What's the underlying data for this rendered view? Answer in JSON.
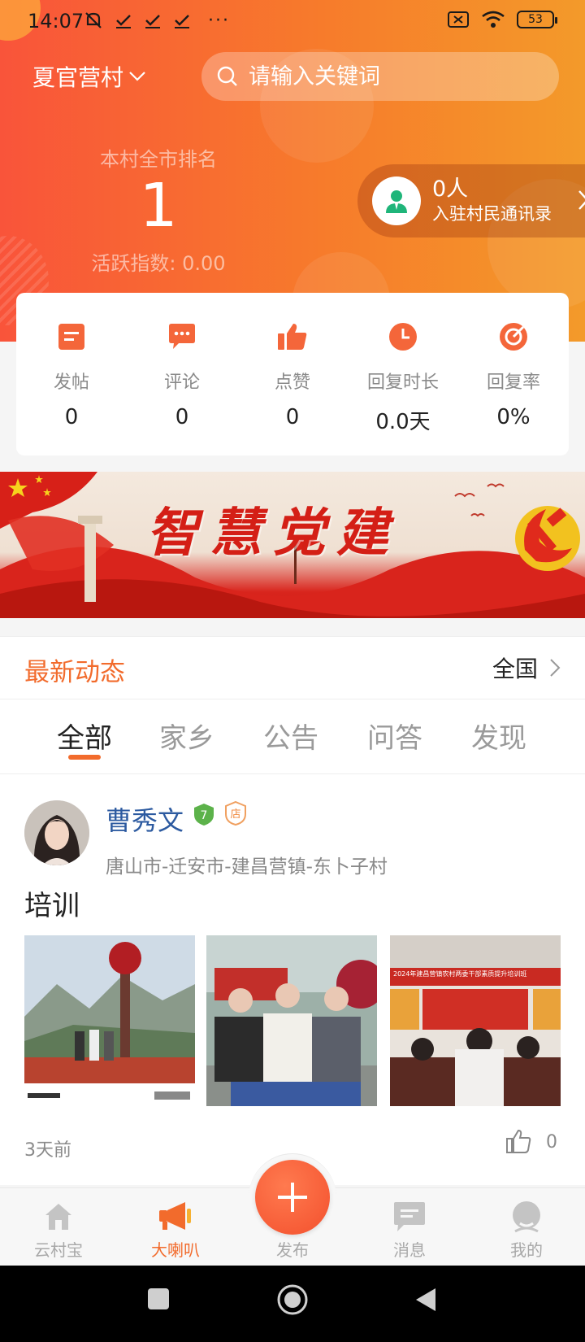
{
  "status_bar": {
    "time": "14:07",
    "battery": "53",
    "more": "···"
  },
  "header": {
    "village": "夏官营村",
    "search_placeholder": "请输入关键词",
    "rank_label": "本村全市排名",
    "rank_value": "1",
    "activity_index": "活跃指数: 0.00",
    "directory_count": "0人",
    "directory_label": "入驻村民通讯录"
  },
  "stats": [
    {
      "icon": "post-icon",
      "label": "发帖",
      "value": "0"
    },
    {
      "icon": "comment-icon",
      "label": "评论",
      "value": "0"
    },
    {
      "icon": "thumbs-up-icon",
      "label": "点赞",
      "value": "0"
    },
    {
      "icon": "clock-icon",
      "label": "回复时长",
      "value": "0.0天"
    },
    {
      "icon": "reply-rate-icon",
      "label": "回复率",
      "value": "0%"
    }
  ],
  "banner": {
    "text": "智慧党建"
  },
  "latest": {
    "title": "最新动态",
    "scope": "全国"
  },
  "tabs": [
    {
      "label": "全部",
      "active": true
    },
    {
      "label": "家乡",
      "active": false
    },
    {
      "label": "公告",
      "active": false
    },
    {
      "label": "问答",
      "active": false
    },
    {
      "label": "发现",
      "active": false
    }
  ],
  "post": {
    "author": "曹秀文",
    "level": "7",
    "shop_badge": "店",
    "location": "唐山市-迁安市-建昌营镇-东卜子村",
    "text": "培训",
    "photo3_caption_line1": "2024年建昌营镇农村两委干部素质提升培训班",
    "time": "3天前",
    "likes": "0"
  },
  "bottom_nav": [
    {
      "icon": "home-icon",
      "label": "云村宝",
      "active": false
    },
    {
      "icon": "megaphone-icon",
      "label": "大喇叭",
      "active": true
    },
    {
      "icon": "plus-icon",
      "label": "发布",
      "active": false
    },
    {
      "icon": "message-icon",
      "label": "消息",
      "active": false
    },
    {
      "icon": "profile-icon",
      "label": "我的",
      "active": false
    }
  ],
  "colors": {
    "accent": "#f26b2c",
    "hero_start": "#f9543a",
    "hero_end": "#f39a2a",
    "author": "#2c5aa0"
  }
}
